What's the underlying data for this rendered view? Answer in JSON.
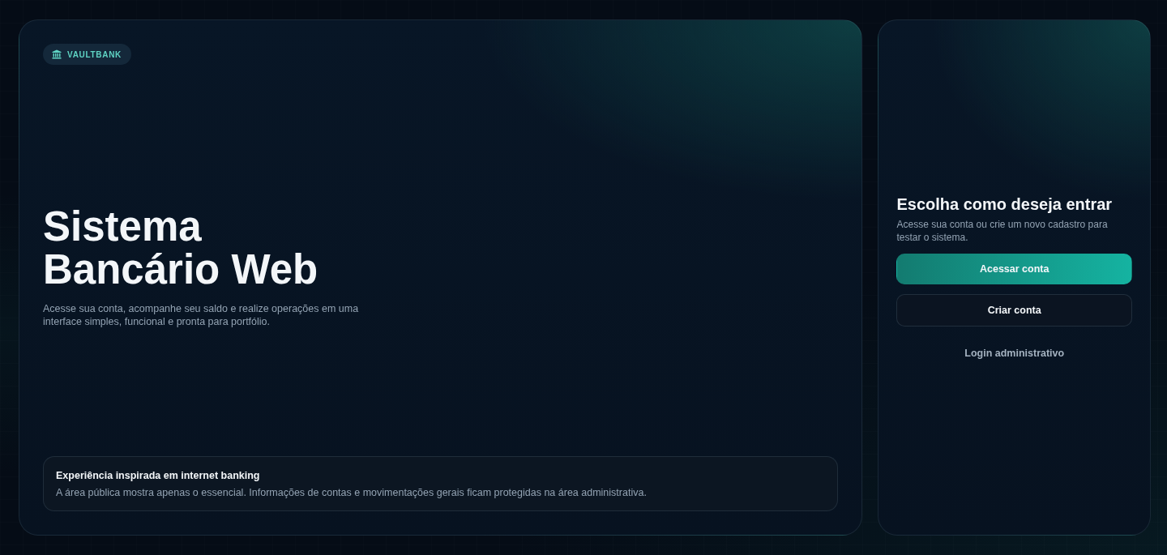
{
  "brand": {
    "name": "VAULTBANK"
  },
  "hero": {
    "title_lines": [
      "Sistema",
      "Bancário Web"
    ],
    "description": "Acesse sua conta, acompanhe seu saldo e realize operações em uma interface simples, funcional e pronta para portfólio."
  },
  "info_box": {
    "title": "Experiência inspirada em internet banking",
    "text": "A área pública mostra apenas o essencial. Informações de contas e movimentações gerais ficam protegidas na área administrativa."
  },
  "login_panel": {
    "title": "Escolha como deseja entrar",
    "description": "Acesse sua conta ou crie um novo cadastro para testar o sistema.",
    "buttons": [
      {
        "label": "Acessar conta",
        "kind": "primary"
      },
      {
        "label": "Criar conta",
        "kind": "secondary"
      }
    ],
    "link": "Login administrativo"
  }
}
